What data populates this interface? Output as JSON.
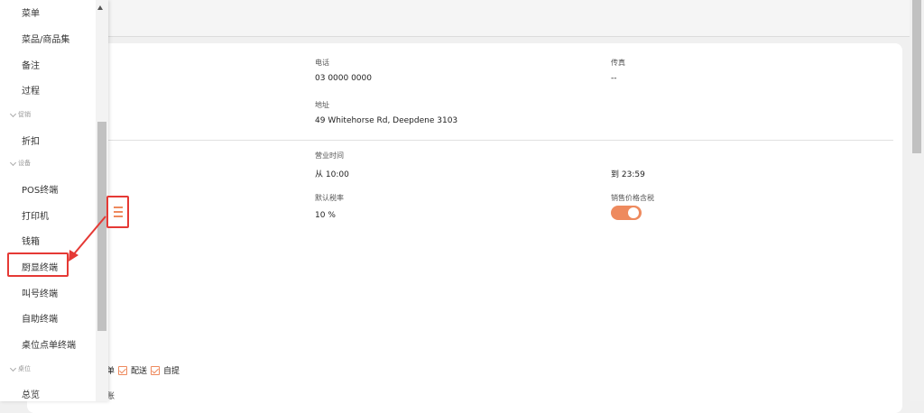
{
  "menu": {
    "items": [
      {
        "label": "菜单"
      },
      {
        "label": "菜品/商品集"
      },
      {
        "label": "备注"
      },
      {
        "label": "过程"
      },
      {
        "group": "促销"
      },
      {
        "label": "折扣"
      },
      {
        "group": "设备"
      },
      {
        "label": "POS终端"
      },
      {
        "label": "打印机"
      },
      {
        "label": "钱箱"
      },
      {
        "label": "厨显终端"
      },
      {
        "label": "叫号终端"
      },
      {
        "label": "自助终端"
      },
      {
        "label": "桌位点单终端"
      },
      {
        "group": "桌位"
      },
      {
        "label": "总览"
      }
    ]
  },
  "store": {
    "phone_label": "电话",
    "phone_value": "03 0000 0000",
    "fax_label": "传真",
    "fax_value": "--",
    "address_label": "地址",
    "address_value": "49 Whitehorse Rd, Deepdene 3103",
    "hours_label": "营业时间",
    "hours_from": "从 10:00",
    "hours_to": "到 23:59",
    "tax_label": "默认税率",
    "tax_value": "10 %",
    "tax_incl_label": "销售价格含税",
    "tax_incl_enabled": true
  },
  "order_types": {
    "partial_label": "速点单",
    "delivery_label": "配送",
    "pickup_label": "自提",
    "delivery_checked": true,
    "pickup_checked": true,
    "partial_next": "账"
  },
  "colors": {
    "accent": "#ee8a5e",
    "annotation": "#e53935"
  },
  "icons": {
    "hamburger": "menu-icon",
    "scroll_up": "caret-up-icon"
  }
}
